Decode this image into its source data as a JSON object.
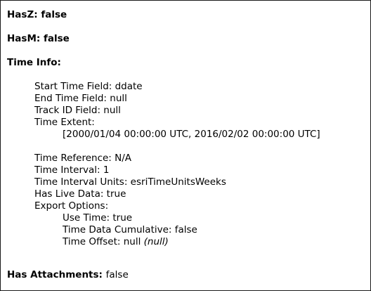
{
  "hasz": {
    "label": "HasZ:",
    "value": "false"
  },
  "hasm": {
    "label": "HasM:",
    "value": "false"
  },
  "time_info": {
    "heading": "Time Info:",
    "start_time_field": "Start Time Field: ddate",
    "end_time_field": "End Time Field: null",
    "track_id_field": "Track ID Field: null",
    "time_extent_label": "Time Extent:",
    "time_extent_value": "[2000/01/04 00:00:00 UTC, 2016/02/02 00:00:00 UTC]",
    "time_reference": "Time Reference: N/A",
    "time_interval": "Time Interval: 1",
    "time_interval_units": "Time Interval Units: esriTimeUnitsWeeks",
    "has_live_data": "Has Live Data: true",
    "export_options": {
      "label": "Export Options:",
      "use_time": "Use Time: true",
      "time_data_cumulative": "Time Data Cumulative: false",
      "time_offset": "Time Offset: null",
      "time_offset_note": "(null)"
    }
  },
  "has_attachments": {
    "label": "Has Attachments:",
    "value": "false"
  }
}
